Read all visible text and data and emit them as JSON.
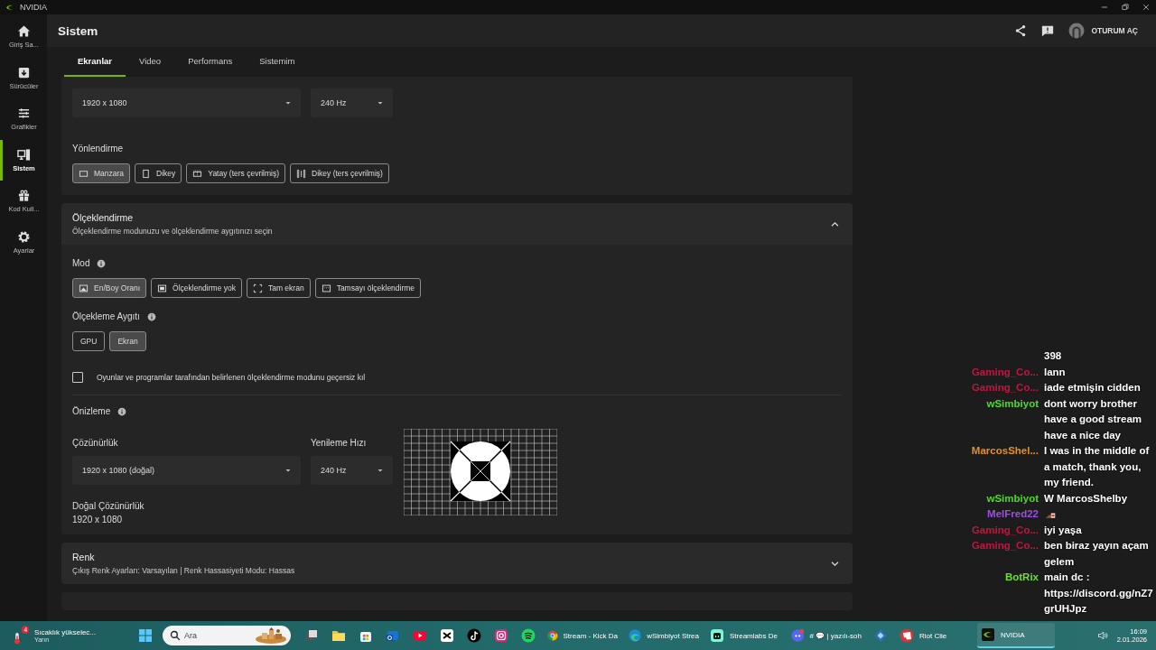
{
  "window": {
    "title": "NVIDIA"
  },
  "sidebar": {
    "items": [
      {
        "label": "Giriş Sa...",
        "kind": "home",
        "selected": false
      },
      {
        "label": "Sürücüler",
        "kind": "driver",
        "selected": false
      },
      {
        "label": "Grafikler",
        "kind": "sliders",
        "selected": false
      },
      {
        "label": "Sistem",
        "kind": "system",
        "selected": true
      },
      {
        "label": "Kod Kull...",
        "kind": "gift",
        "selected": false
      },
      {
        "label": "Ayarlar",
        "kind": "gear",
        "selected": false
      }
    ]
  },
  "header": {
    "title": "Sistem",
    "sign_in": "OTURUM AÇ"
  },
  "tabs": [
    {
      "label": "Ekranlar",
      "selected": true
    },
    {
      "label": "Video",
      "selected": false
    },
    {
      "label": "Performans",
      "selected": false
    },
    {
      "label": "Sistemim",
      "selected": false
    }
  ],
  "display_panel": {
    "resolution": "1920 x 1080",
    "refresh_rate": "240 Hz",
    "orientation_label": "Yönlendirme",
    "orientations": [
      {
        "label": "Manzara",
        "kind": "landscape",
        "selected": true
      },
      {
        "label": "Dikey",
        "kind": "portrait",
        "selected": false
      },
      {
        "label": "Yatay (ters çevrilmiş)",
        "kind": "landscape-flip",
        "selected": false
      },
      {
        "label": "Dikey (ters çevrilmiş)",
        "kind": "portrait-flip",
        "selected": false
      }
    ]
  },
  "scaling_panel": {
    "title": "Ölçeklendirme",
    "subtitle": "Ölçeklendirme modunuzu ve ölçeklendirme aygıtınızı seçin",
    "expanded": true,
    "mode_label": "Mod",
    "modes": [
      {
        "label": "En/Boy Oranı",
        "kind": "aspect",
        "selected": true
      },
      {
        "label": "Ölçeklendirme yok",
        "kind": "none",
        "selected": false
      },
      {
        "label": "Tam ekran",
        "kind": "full",
        "selected": false
      },
      {
        "label": "Tamsayı ölçeklendirme",
        "kind": "integer",
        "selected": false
      }
    ],
    "device_label": "Ölçekleme Aygıtı",
    "devices": [
      {
        "label": "GPU",
        "selected": false
      },
      {
        "label": "Ekran",
        "selected": true
      }
    ],
    "override": {
      "label": "Oyunlar ve programlar tarafından belirlenen ölçeklendirme modunu geçersiz kıl",
      "checked": false
    },
    "preview_label": "Önizleme",
    "resolution_label": "Çözünürlük",
    "resolution": "1920 x 1080 (doğal)",
    "refresh_label": "Yenileme Hızı",
    "refresh_rate": "240 Hz",
    "native_label": "Doğal Çözünürlük",
    "native_value": "1920 x 1080"
  },
  "color_panel": {
    "title": "Renk",
    "subtitle": "Çıkış Renk Ayarları: Varsayılan | Renk Hassasiyeti Modu: Hassas",
    "expanded": false
  },
  "chat": {
    "messages": [
      {
        "kind": "text",
        "text": "398"
      },
      {
        "kind": "text",
        "user": "Gaming_Co...",
        "color": "#c0163f",
        "text": "lann"
      },
      {
        "kind": "text",
        "user": "Gaming_Co...",
        "color": "#c0163f",
        "text": "iade etmişin cidden"
      },
      {
        "kind": "text",
        "user": "wSimbiyot",
        "color": "#4fd82c",
        "text": "dont worry brother have a good stream have a nice day"
      },
      {
        "kind": "text",
        "user": "MarcosShel...",
        "color": "#e7901c",
        "text": "I was in the middle of a match, thank you, my friend."
      },
      {
        "kind": "text",
        "user": "wSimbiyot",
        "color": "#4fd82c",
        "text": "W MarcosShelby"
      },
      {
        "kind": "emote",
        "user": "MelFred22",
        "color": "#9b4fe0"
      },
      {
        "kind": "text",
        "user": "Gaming_Co...",
        "color": "#c0163f",
        "text": "iyi yaşa"
      },
      {
        "kind": "text",
        "user": "Gaming_Co...",
        "color": "#c0163f",
        "text": "ben biraz yayın açam gelem"
      },
      {
        "kind": "text",
        "user": "BotRix",
        "color": "#6ee02a",
        "text": "main dc : https://discord.gg/nZ7grUHJpz"
      }
    ]
  },
  "taskbar": {
    "weather": {
      "text": "Sıcaklık yükselec...",
      "subtext": "Yarın",
      "badge": "4"
    },
    "search": {
      "placeholder": "Ara"
    },
    "apps": [
      {
        "kind": "taskview",
        "selected": false
      },
      {
        "kind": "files",
        "selected": false
      },
      {
        "kind": "store",
        "selected": false
      },
      {
        "kind": "mail",
        "selected": false
      },
      {
        "kind": "youtube",
        "selected": false
      },
      {
        "kind": "capcut",
        "selected": false
      },
      {
        "kind": "tiktok",
        "selected": false
      },
      {
        "kind": "instagram",
        "selected": false
      },
      {
        "kind": "spotify",
        "selected": false
      },
      {
        "kind": "chrome",
        "label": "Stream - Kick Da",
        "selected": false
      },
      {
        "kind": "edge",
        "label": "wSimbiyot Strea",
        "selected": false
      },
      {
        "kind": "streamlabs",
        "label": "Streamlabs De",
        "selected": false
      },
      {
        "kind": "discord",
        "label": "# 💬 | yazılı-soh",
        "selected": false
      },
      {
        "kind": "diamond",
        "selected": false
      },
      {
        "kind": "riot",
        "label": "Riot Clie",
        "selected": false
      },
      {
        "kind": "nvidia",
        "label": "NVIDIA",
        "selected": true
      }
    ],
    "clock": {
      "time": "16:09",
      "date": "2.01.2026"
    }
  }
}
